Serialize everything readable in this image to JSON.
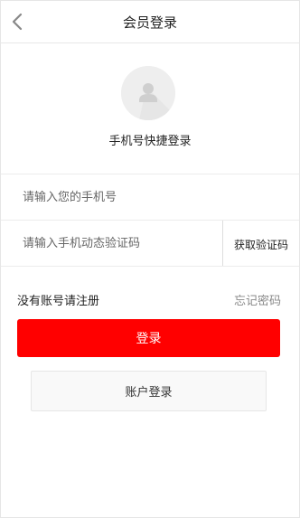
{
  "header": {
    "title": "会员登录",
    "back_icon": "chevron-left-icon"
  },
  "avatar": {
    "icon": "user-avatar-icon"
  },
  "quick_login": {
    "title": "手机号快捷登录"
  },
  "form": {
    "phone_placeholder": "请输入您的手机号",
    "code_placeholder": "请输入手机动态验证码",
    "get_code_label": "获取验证码"
  },
  "links": {
    "register": "没有账号请注册",
    "forgot_password": "忘记密码"
  },
  "buttons": {
    "login": "登录",
    "account_login": "账户登录"
  },
  "colors": {
    "primary": "#ff0000",
    "avatar_bg": "#eeeeee"
  }
}
